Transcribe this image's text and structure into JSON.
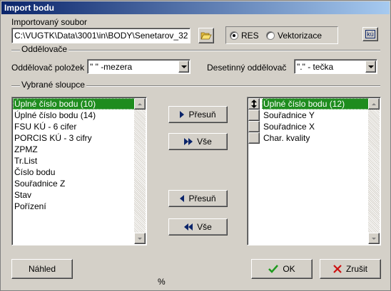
{
  "window": {
    "title": "Import bodu"
  },
  "file": {
    "label": "Importovaný soubor",
    "path": "C:\\VUGTK\\Data\\3001\\in\\BODY\\Senetarov_32"
  },
  "mode": {
    "options": [
      "RES",
      "Vektorizace"
    ],
    "selected": "RES"
  },
  "ku_button": {
    "label": "kú"
  },
  "separators": {
    "group_title": "Oddělovače",
    "item_sep_label": "Oddělovač položek",
    "item_sep_value": "\" \" -mezera",
    "decimal_sep_label": "Desetinný oddělovač",
    "decimal_sep_value": "\".\" - tečka"
  },
  "columns": {
    "group_title": "Vybrané sloupce",
    "available": [
      "Úplné číslo bodu (10)",
      "Úplné číslo bodu (14)",
      "FSU KÚ - 6 cifer",
      "PORCIS KÚ - 3 cifry",
      "ZPMZ",
      "Tr.List",
      "Číslo bodu",
      "Souřadnice Z",
      "Stav",
      "Pořízení"
    ],
    "available_selected_index": 0,
    "selected": [
      "Úplné číslo bodu (12)",
      "Souřadnice Y",
      "Souřadnice X",
      "Char. kvality"
    ],
    "selected_selected_index": 0
  },
  "move_buttons": {
    "move_right": "Přesuň",
    "all_right": "Vše",
    "move_left": "Přesuň",
    "all_left": "Vše"
  },
  "footer": {
    "preview": "Náhled",
    "percent": "%",
    "ok": "OK",
    "cancel": "Zrušit"
  },
  "colors": {
    "selection": "#1e8c1e",
    "titlebar": "#0a246a",
    "ok_check": "#1e9a1e",
    "cancel_x": "#cc1111"
  }
}
